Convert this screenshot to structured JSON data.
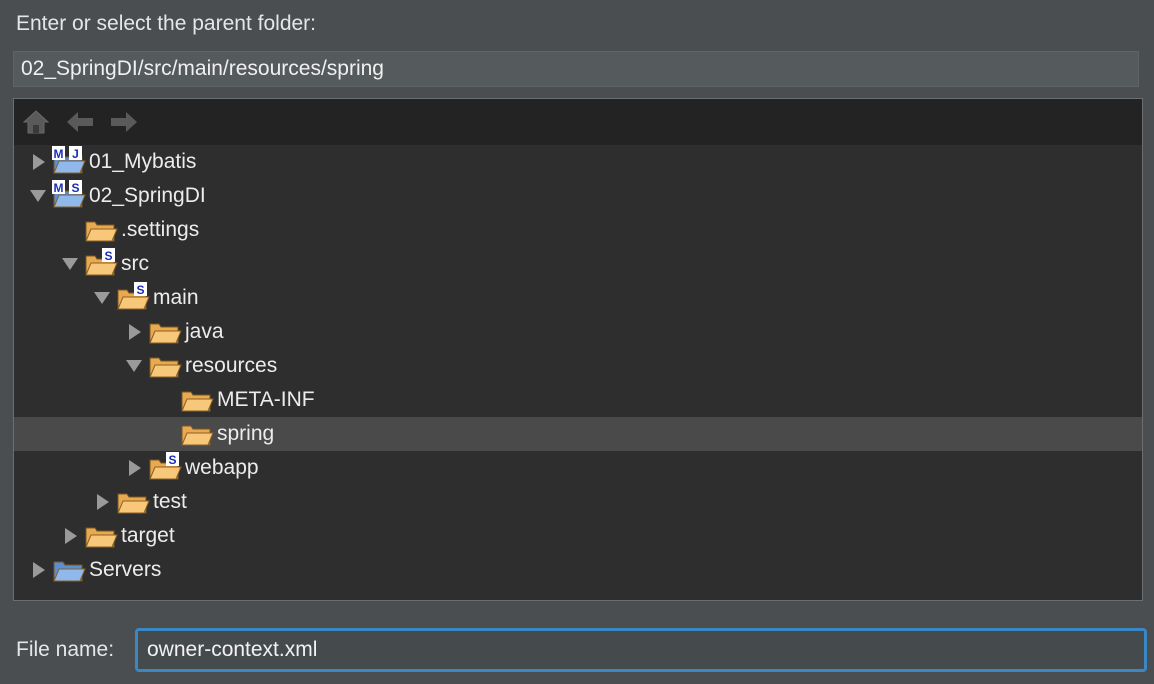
{
  "dialog": {
    "prompt": "Enter or select the parent folder:",
    "parent_path": "02_SpringDI/src/main/resources/spring",
    "file_name_label": "File name:",
    "file_name_value": "owner-context.xml"
  },
  "toolbar": {
    "icons": [
      "home-icon",
      "back-arrow-icon",
      "forward-arrow-icon"
    ]
  },
  "tree": [
    {
      "label": "01_Mybatis",
      "depth": 0,
      "expander": "collapsed",
      "kind": "project",
      "badges": [
        "M",
        "J"
      ]
    },
    {
      "label": "02_SpringDI",
      "depth": 0,
      "expander": "expanded",
      "kind": "project",
      "badges": [
        "M",
        "S"
      ]
    },
    {
      "label": ".settings",
      "depth": 1,
      "expander": "none",
      "kind": "folder",
      "badges": []
    },
    {
      "label": "src",
      "depth": 1,
      "expander": "expanded",
      "kind": "folder",
      "badges": [
        "S"
      ]
    },
    {
      "label": "main",
      "depth": 2,
      "expander": "expanded",
      "kind": "folder",
      "badges": [
        "S"
      ]
    },
    {
      "label": "java",
      "depth": 3,
      "expander": "collapsed",
      "kind": "folder",
      "badges": []
    },
    {
      "label": "resources",
      "depth": 3,
      "expander": "expanded",
      "kind": "folder",
      "badges": []
    },
    {
      "label": "META-INF",
      "depth": 4,
      "expander": "none",
      "kind": "folder",
      "badges": []
    },
    {
      "label": "spring",
      "depth": 4,
      "expander": "none",
      "kind": "folder",
      "badges": [],
      "selected": true
    },
    {
      "label": "webapp",
      "depth": 3,
      "expander": "collapsed",
      "kind": "folder",
      "badges": [
        "S"
      ]
    },
    {
      "label": "test",
      "depth": 2,
      "expander": "collapsed",
      "kind": "folder",
      "badges": []
    },
    {
      "label": "target",
      "depth": 1,
      "expander": "collapsed",
      "kind": "folder",
      "badges": []
    },
    {
      "label": "Servers",
      "depth": 0,
      "expander": "collapsed",
      "kind": "project",
      "badges": []
    }
  ],
  "colors": {
    "selection": "#4a4a4a",
    "focus_ring": "#3b86c5",
    "folder": "#f2b15c",
    "project_folder": "#6b9ad6",
    "badge": "#1b2fb5"
  }
}
